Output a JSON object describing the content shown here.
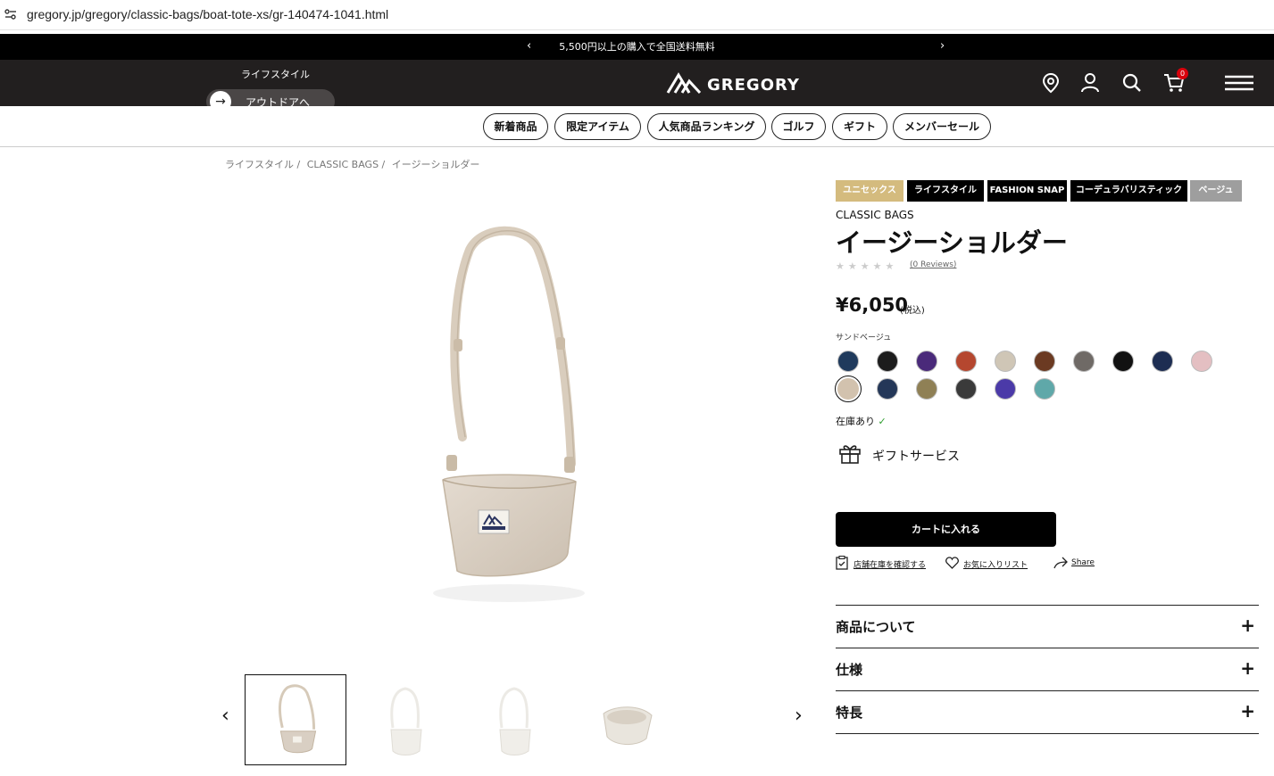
{
  "browser": {
    "url": "gregory.jp/gregory/classic-bags/boat-tote-xs/gr-140474-1041.html"
  },
  "promo": {
    "text": "5,500円以上の購入で全国送料無料",
    "prev": "‹",
    "next": "›"
  },
  "header": {
    "lifestyle_label": "ライフスタイル",
    "outdoor_label": "アウトドアへ",
    "logo_text": "GREGORY",
    "cart_count": "0"
  },
  "categories": [
    "新着商品",
    "限定アイテム",
    "人気商品ランキング",
    "ゴルフ",
    "ギフト",
    "メンバーセール"
  ],
  "breadcrumb": [
    "ライフスタイル /",
    "CLASSIC BAGS /",
    "イージーショルダー"
  ],
  "product": {
    "tags": [
      {
        "label": "ユニセックス",
        "color": "#d4bb7e"
      },
      {
        "label": "ライフスタイル",
        "color": "#000000"
      },
      {
        "label": "FASHION SNAP",
        "color": "#000000"
      },
      {
        "label": "コーデュラバリスティック",
        "color": "#000000"
      },
      {
        "label": "ベージュ",
        "color": "#9e9e9e"
      }
    ],
    "collection": "CLASSIC BAGS",
    "title": "イージーショルダー",
    "stars": "★★★★★",
    "reviews": "(0 Reviews)",
    "price": "¥6,050",
    "tax_label": "(税込)",
    "color_name": "サンドベージュ",
    "swatches_row1": [
      "#1f3a5c",
      "#1c1c1c",
      "#4a2a7a",
      "#b5472f",
      "#cfc6b6",
      "#6b3a22",
      "#6f6a66",
      "#111111",
      "#1d2d52",
      "#e4bfc2"
    ],
    "swatches_row2": [
      "#d2c2ae",
      "#243758",
      "#8f8055",
      "#3a3a3a",
      "#4b3aa8",
      "#5fa8a9"
    ],
    "stock": "在庫あり",
    "stock_check": "✓",
    "gift_service": "ギフトサービス",
    "add_to_cart": "カートに入れる",
    "store_stock": "店舗在庫を確認する",
    "wishlist": "お気に入りリスト",
    "share": "Share"
  },
  "accordions": [
    "商品について",
    "仕様",
    "特長"
  ],
  "thumbs": {
    "prev": "‹",
    "next": "›"
  },
  "accent": {
    "header_bg": "#221f1f",
    "badge_red": "#d8000c"
  }
}
